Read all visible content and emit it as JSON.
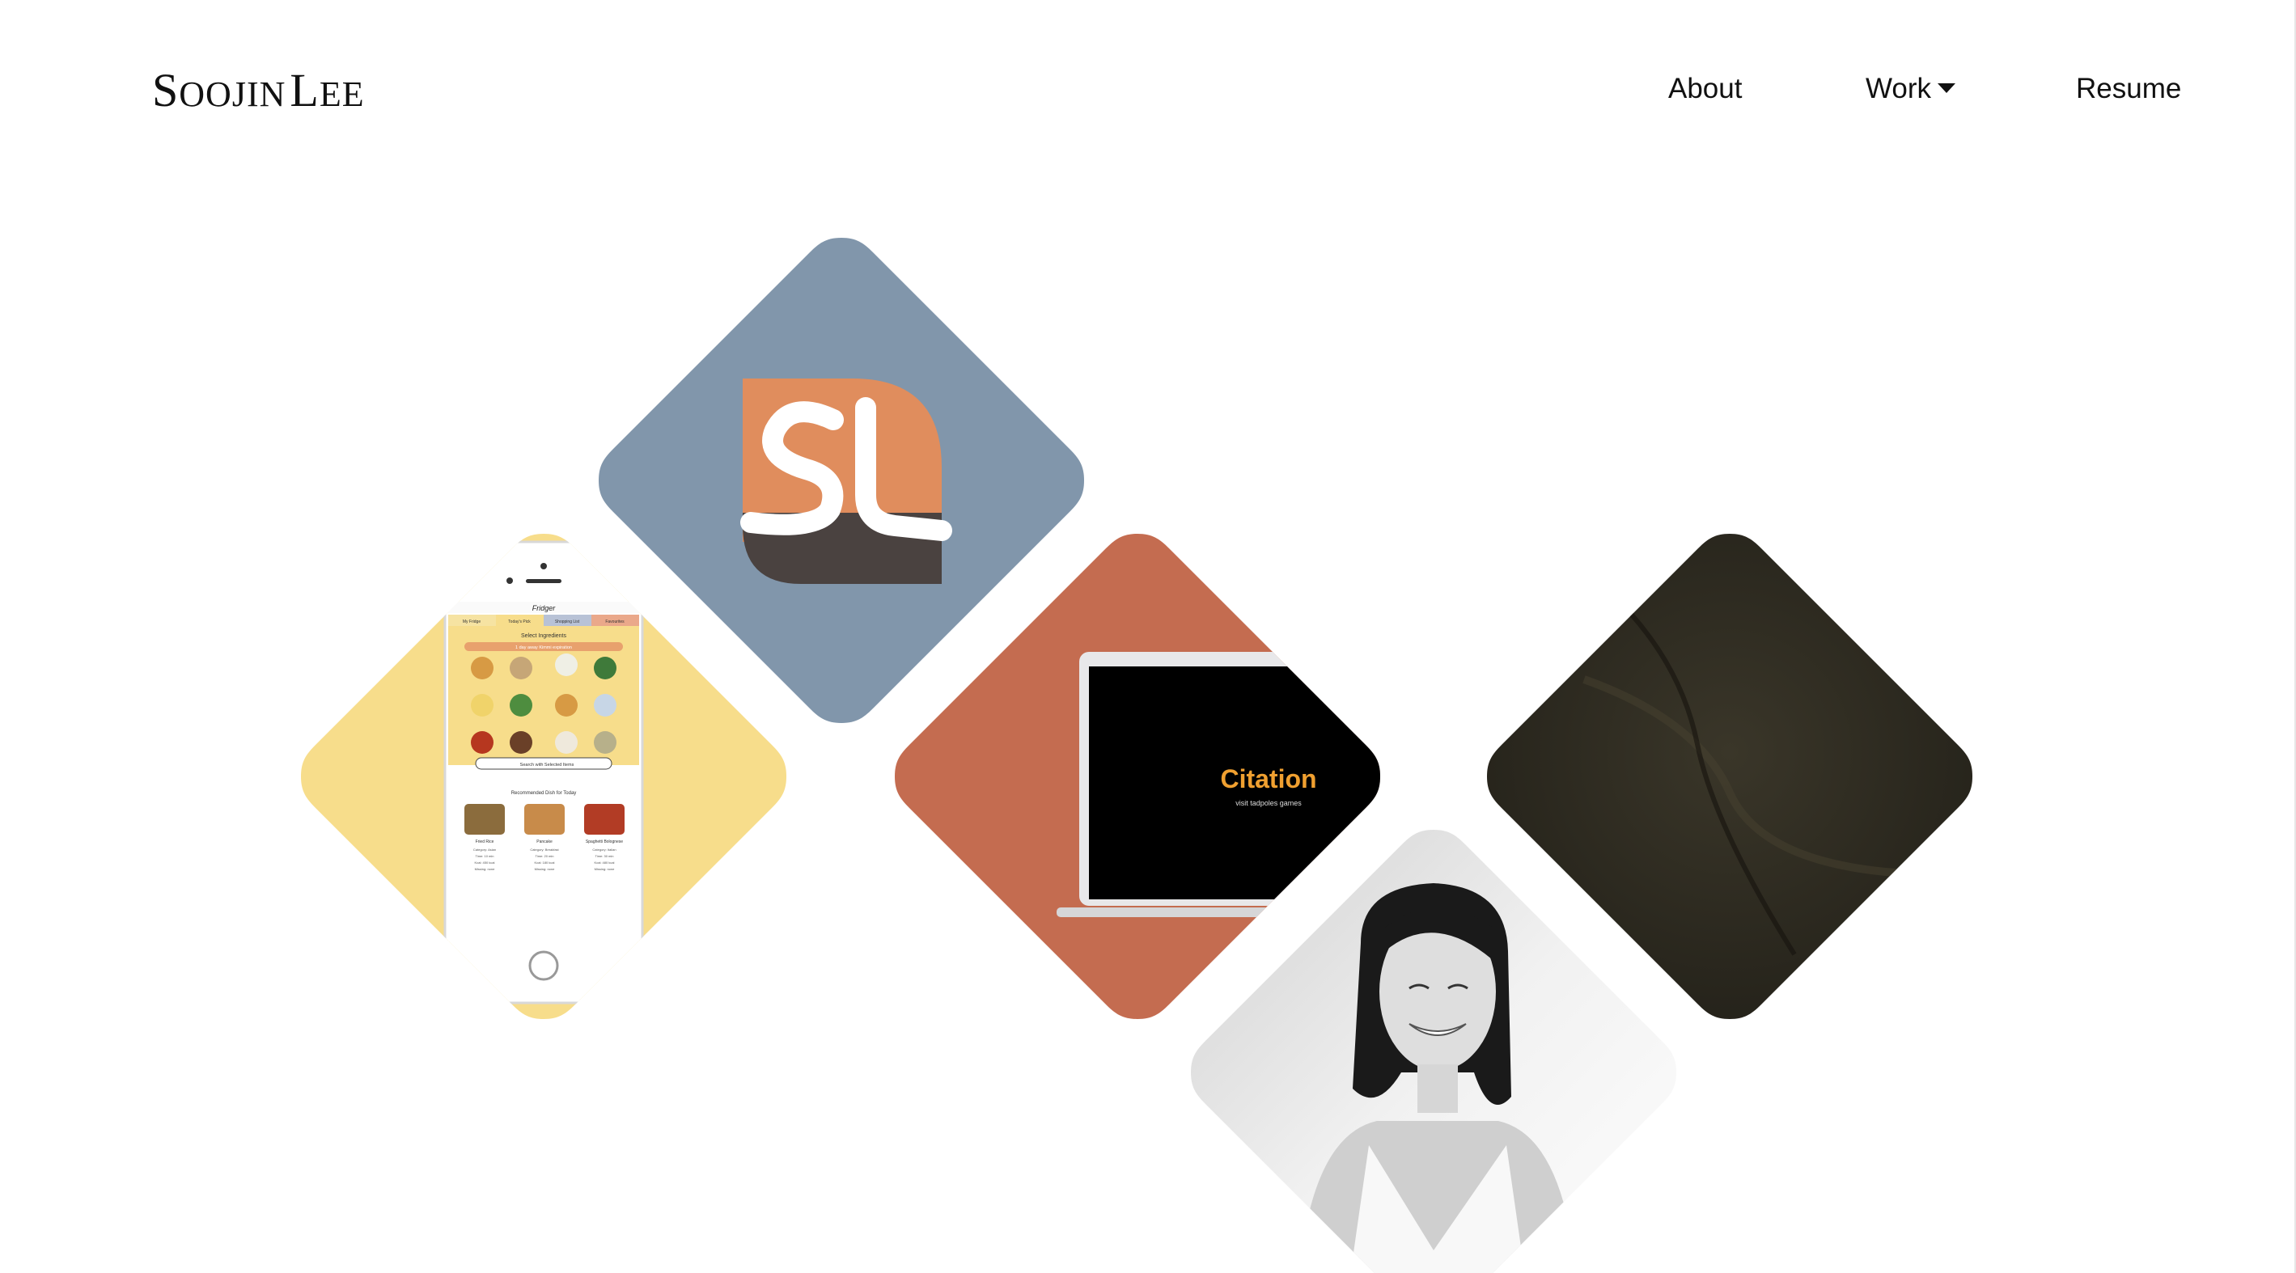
{
  "header": {
    "logo": {
      "first_initial": "S",
      "first_rest": "oojin",
      "last_initial": "L",
      "last_rest": "ee"
    },
    "nav": {
      "about": "About",
      "work": "Work",
      "resume": "Resume"
    },
    "icons": {
      "work_dropdown": "caret-down-icon"
    }
  },
  "tiles": {
    "logo_tile": {
      "initials": "SL",
      "bg": "#8196ab",
      "accent": "#e08d5d",
      "dark": "#4a4240"
    },
    "fridge_tile": {
      "bg": "#f7dd8b",
      "app_name": "Fridger",
      "tabs": [
        "My Fridge",
        "Today's Pick",
        "Shopping List",
        "Favourites"
      ],
      "section_title": "Select Ingredients",
      "banner": "1 day away Kimmi expiration",
      "search_button": "Search with Selected Items",
      "recommend_title": "Recommended Dish for Today",
      "dishes": [
        {
          "name": "Fried Rice",
          "lines": [
            "Category: Asian",
            "Time: 10 min",
            "Kcal: 450 kcal",
            "Missing: none"
          ]
        },
        {
          "name": "Pancake",
          "lines": [
            "Category: Breakfast",
            "Time: 20 min",
            "Kcal: 180 kcal",
            "Missing: none"
          ]
        },
        {
          "name": "Spaghetti Bolognese",
          "lines": [
            "Category: Italian",
            "Time: 30 min",
            "Kcal: 480 kcal",
            "Missing: none"
          ]
        }
      ]
    },
    "citation_tile": {
      "bg": "#c46c50",
      "title": "Citation",
      "subtitle": "visit tadpoles games"
    },
    "texture_tile": {
      "bg": "#2e2b22"
    },
    "portrait_tile": {
      "bg": "#f4f4f4"
    }
  }
}
